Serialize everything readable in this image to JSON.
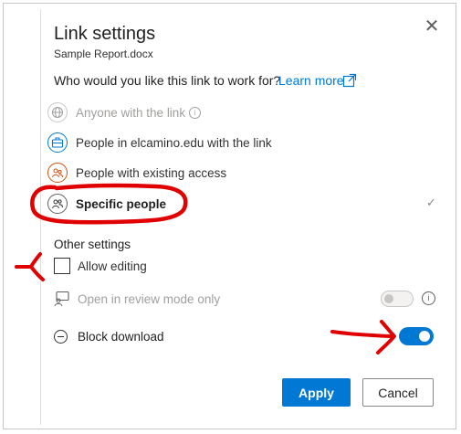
{
  "dialog": {
    "title": "Link settings",
    "subtitle": "Sample Report.docx",
    "question": "Who would you like this link to work for?",
    "learn_more": "Learn more"
  },
  "options": [
    {
      "label": "Anyone with the link",
      "icon": "globe-icon",
      "disabled": true
    },
    {
      "label": "People in elcamino.edu with the link",
      "icon": "briefcase-icon",
      "disabled": false
    },
    {
      "label": "People with existing access",
      "icon": "people-icon",
      "disabled": false
    },
    {
      "label": "Specific people",
      "icon": "person-group-icon",
      "selected": true
    }
  ],
  "selected_mark": "✓",
  "other_settings": {
    "heading": "Other settings",
    "allow_editing": {
      "label": "Allow editing",
      "checked": false
    },
    "review_mode": {
      "label": "Open in review mode only",
      "enabled": false,
      "on": false
    },
    "block_download": {
      "label": "Block download",
      "on": true
    }
  },
  "buttons": {
    "apply": "Apply",
    "cancel": "Cancel"
  },
  "colors": {
    "accent": "#0078d4",
    "annotation": "#e00000"
  }
}
